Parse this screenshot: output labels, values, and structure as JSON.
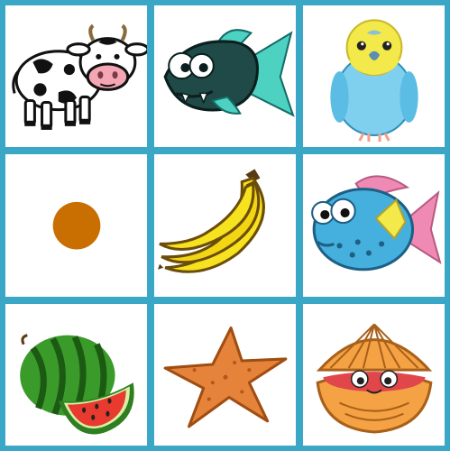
{
  "board": {
    "grid_color": "#3aa7c6",
    "card_color": "#ffffff",
    "rows": 3,
    "columns": 3,
    "cards": [
      {
        "icon": "cow-icon"
      },
      {
        "icon": "piranha-fish-icon"
      },
      {
        "icon": "parakeet-bird-icon"
      },
      {
        "icon": "orange-dot-icon"
      },
      {
        "icon": "banana-bunch-icon"
      },
      {
        "icon": "blue-pufferfish-icon"
      },
      {
        "icon": "watermelon-icon"
      },
      {
        "icon": "starfish-icon"
      },
      {
        "icon": "clam-shell-icon"
      }
    ]
  }
}
